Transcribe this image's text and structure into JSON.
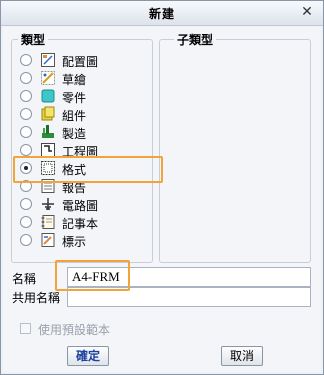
{
  "window": {
    "title": "新建",
    "close_glyph": "✕"
  },
  "type_group": {
    "legend": "類型",
    "selected": "格式",
    "items": [
      {
        "label": "配置圖",
        "icon": "layout-icon"
      },
      {
        "label": "草繪",
        "icon": "sketch-icon"
      },
      {
        "label": "零件",
        "icon": "part-icon"
      },
      {
        "label": "組件",
        "icon": "assembly-icon"
      },
      {
        "label": "製造",
        "icon": "manufacturing-icon"
      },
      {
        "label": "工程圖",
        "icon": "drawing-icon"
      },
      {
        "label": "格式",
        "icon": "format-icon"
      },
      {
        "label": "報告",
        "icon": "report-icon"
      },
      {
        "label": "電路圖",
        "icon": "diagram-icon"
      },
      {
        "label": "記事本",
        "icon": "notebook-icon"
      },
      {
        "label": "標示",
        "icon": "markup-icon"
      }
    ]
  },
  "subtype_group": {
    "legend": "子類型"
  },
  "name_field": {
    "label": "名稱",
    "value": "A4-FRM"
  },
  "common_name_field": {
    "label": "共用名稱",
    "value": ""
  },
  "use_default_template": {
    "label": "使用預設範本",
    "checked": false,
    "enabled": false
  },
  "buttons": {
    "ok": "確定",
    "cancel": "取消"
  },
  "highlight_color": "#f2a33a"
}
